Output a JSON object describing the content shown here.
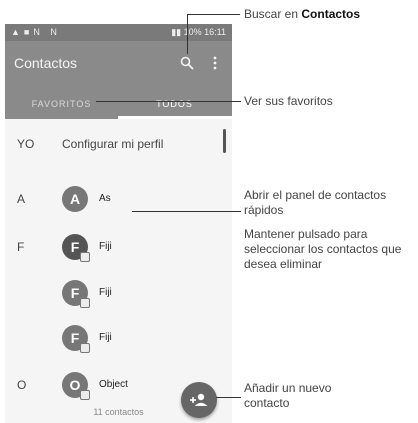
{
  "status_bar": {
    "time": "16:11",
    "battery": "10%"
  },
  "app_bar": {
    "title": "Contactos",
    "icons": [
      "search-icon",
      "more-vert-icon"
    ]
  },
  "tabs": [
    {
      "label": "FAVORITOS"
    },
    {
      "label": "TODOS",
      "selected": true
    }
  ],
  "profile": {
    "letter": "YO",
    "label": "Configurar mi perfil"
  },
  "contacts": [
    {
      "letter": "A",
      "initial": "A",
      "name": "As"
    },
    {
      "letter": "F",
      "initial": "F",
      "name": "Fiji"
    },
    {
      "letter": "",
      "initial": "F",
      "name": "Fiji"
    },
    {
      "letter": "",
      "initial": "F",
      "name": "Fiji"
    },
    {
      "letter": "O",
      "initial": "O",
      "name": "Object"
    }
  ],
  "count_label": "11 contactos",
  "fab": {
    "icon": "add-contact-icon"
  },
  "annotations": {
    "search_prefix": "Buscar en ",
    "search_bold": "Contactos",
    "favorites": "Ver sus favoritos",
    "quick_panel": "Abrir el panel de contactos rápidos",
    "long_press": "Mantener pulsado para seleccionar los contactos que desea eliminar",
    "add_contact": "Añadir un nuevo contacto"
  },
  "colors": {
    "app_bar": "#8a8a8a",
    "status_bar": "#7a7a7a",
    "avatar": "#777777",
    "fab": "#666666"
  }
}
